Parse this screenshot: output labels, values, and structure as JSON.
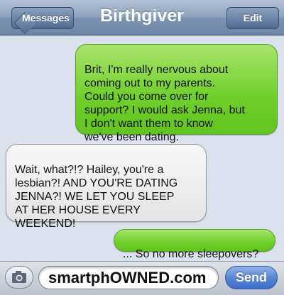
{
  "header": {
    "title": "Birthgiver",
    "back_label": "Messages",
    "edit_label": "Edit"
  },
  "messages": [
    {
      "direction": "sent",
      "text": "Brit, I'm really nervous about\ncoming out to my parents.\nCould you come over for\nsupport? I would ask Jenna, but\nI don't want them to know\nwe've been dating."
    },
    {
      "direction": "received",
      "text": "Wait, what?!? Hailey, you're a\nlesbian?! AND YOU'RE DATING\nJENNA?! WE LET YOU SLEEP\nAT HER HOUSE EVERY\nWEEKEND!"
    },
    {
      "direction": "sent",
      "text": "... So no more sleepovers?"
    }
  ],
  "composer": {
    "input_value": "smartphOWNED.com",
    "send_label": "Send",
    "camera_icon": "camera-icon"
  },
  "colors": {
    "sent_bubble": "#6fce2a",
    "received_bubble": "#e9e9e9",
    "background": "#dbe2ed",
    "send_button": "#4a7bd0"
  }
}
